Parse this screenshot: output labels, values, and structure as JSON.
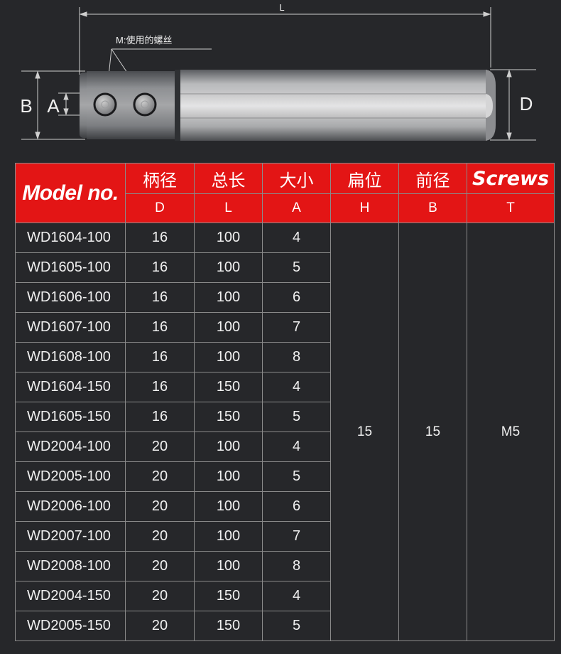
{
  "drawing": {
    "label_L": "L",
    "label_B": "B",
    "label_A": "A",
    "label_D": "D",
    "callout_text": "M:使用的螺丝"
  },
  "table": {
    "model_header": "Model no.",
    "columns": [
      {
        "cn": "柄径",
        "code": "D"
      },
      {
        "cn": "总长",
        "code": "L"
      },
      {
        "cn": "大小",
        "code": "A"
      },
      {
        "cn": "扁位",
        "code": "H"
      },
      {
        "cn": "前径",
        "code": "B"
      },
      {
        "cn": "Screws",
        "code": "T"
      }
    ],
    "rows": [
      {
        "model": "WD1604-100",
        "d": "16",
        "l": "100",
        "a": "4"
      },
      {
        "model": "WD1605-100",
        "d": "16",
        "l": "100",
        "a": "5"
      },
      {
        "model": "WD1606-100",
        "d": "16",
        "l": "100",
        "a": "6"
      },
      {
        "model": "WD1607-100",
        "d": "16",
        "l": "100",
        "a": "7"
      },
      {
        "model": "WD1608-100",
        "d": "16",
        "l": "100",
        "a": "8"
      },
      {
        "model": "WD1604-150",
        "d": "16",
        "l": "150",
        "a": "4"
      },
      {
        "model": "WD1605-150",
        "d": "16",
        "l": "150",
        "a": "5"
      },
      {
        "model": "WD2004-100",
        "d": "20",
        "l": "100",
        "a": "4"
      },
      {
        "model": "WD2005-100",
        "d": "20",
        "l": "100",
        "a": "5"
      },
      {
        "model": "WD2006-100",
        "d": "20",
        "l": "100",
        "a": "6"
      },
      {
        "model": "WD2007-100",
        "d": "20",
        "l": "100",
        "a": "7"
      },
      {
        "model": "WD2008-100",
        "d": "20",
        "l": "100",
        "a": "8"
      },
      {
        "model": "WD2004-150",
        "d": "20",
        "l": "150",
        "a": "4"
      },
      {
        "model": "WD2005-150",
        "d": "20",
        "l": "150",
        "a": "5"
      }
    ],
    "merged": {
      "h": "15",
      "b": "15",
      "t": "M5"
    }
  }
}
